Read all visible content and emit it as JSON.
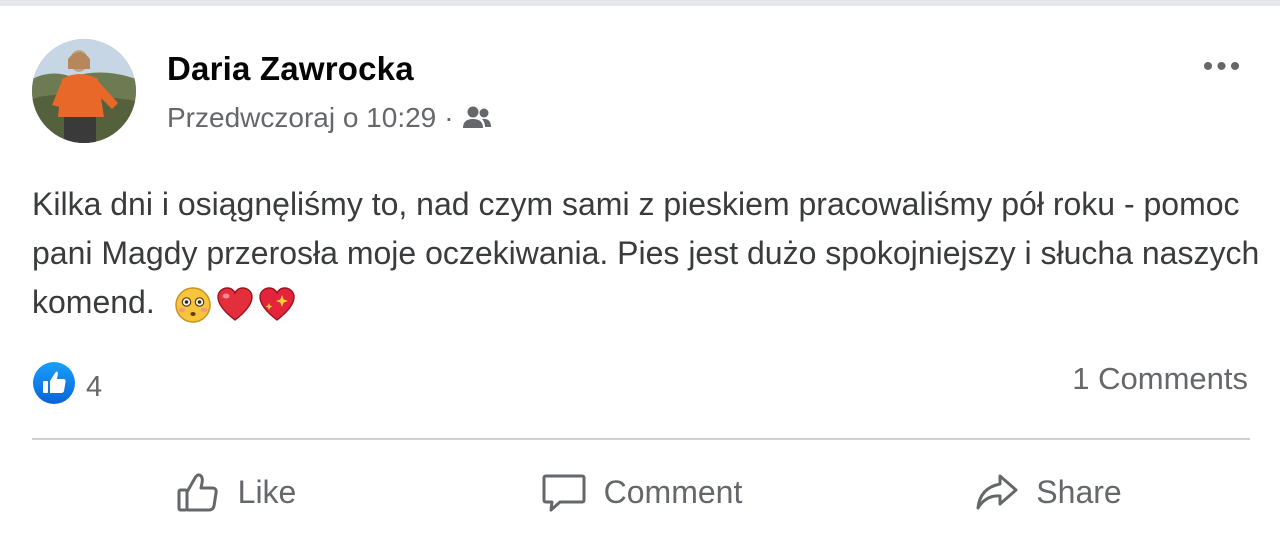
{
  "post": {
    "author": "Daria Zawrocka",
    "timestamp": "Przedwczoraj o 10:29",
    "separator": "·",
    "audience_icon": "friends-icon",
    "more_icon": "•••",
    "text": "Kilka dni i osiągnęliśmy to, nad czym sami z pieskiem pracowaliśmy pół roku - pomoc pani Magdy przerosła moje oczekiwania. Pies jest dużo spokojniejszy i słucha naszych komend.",
    "emojis": [
      "flushed-face-emoji",
      "red-heart-emoji",
      "sparkling-heart-emoji"
    ]
  },
  "stats": {
    "reaction_icon": "like-reaction-icon",
    "reaction_count": "4",
    "comments": "1 Comments"
  },
  "actions": {
    "like": "Like",
    "comment": "Comment",
    "share": "Share"
  },
  "colors": {
    "primary_text": "#050505",
    "secondary_text": "#65676b",
    "like_blue": "#1877f2",
    "divider": "#ced0d4"
  }
}
